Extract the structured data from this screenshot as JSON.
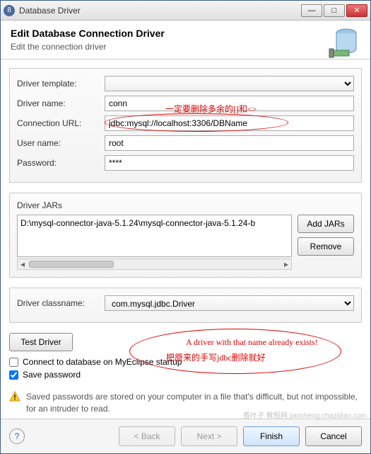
{
  "window": {
    "title": "Database Driver"
  },
  "header": {
    "title": "Edit Database Connection Driver",
    "subtitle": "Edit the connection driver"
  },
  "form": {
    "template_label": "Driver template:",
    "template_value": "",
    "name_label": "Driver name:",
    "name_value": "conn",
    "url_label": "Connection URL:",
    "url_value": "jdbc:mysql://localhost:3306/DBName",
    "user_label": "User name:",
    "user_value": "root",
    "pass_label": "Password:",
    "pass_value": "****"
  },
  "jars": {
    "label": "Driver JARs",
    "items": [
      "D:\\mysql-connector-java-5.1.24\\mysql-connector-java-5.1.24-b"
    ],
    "add": "Add JARs",
    "remove": "Remove"
  },
  "classname": {
    "label": "Driver classname:",
    "value": "com.mysql.jdbc.Driver"
  },
  "test_label": "Test Driver",
  "checks": {
    "connect_label": "Connect to database on MyEclipse startup",
    "connect_checked": false,
    "save_label": "Save password",
    "save_checked": true
  },
  "warning": "Saved passwords are stored on your computer in a file that's difficult, but not impossible, for an intruder to read.",
  "footer": {
    "back": "< Back",
    "next": "Next >",
    "finish": "Finish",
    "cancel": "Cancel"
  },
  "annotations": {
    "a1": "一定要删除多余的[]和<>",
    "a2": "A driver with that name already exists!",
    "a3": "把原来的手写jdbc删除就好"
  },
  "watermark": "香叶子 教程网 jiaocheng.chazidian.com"
}
